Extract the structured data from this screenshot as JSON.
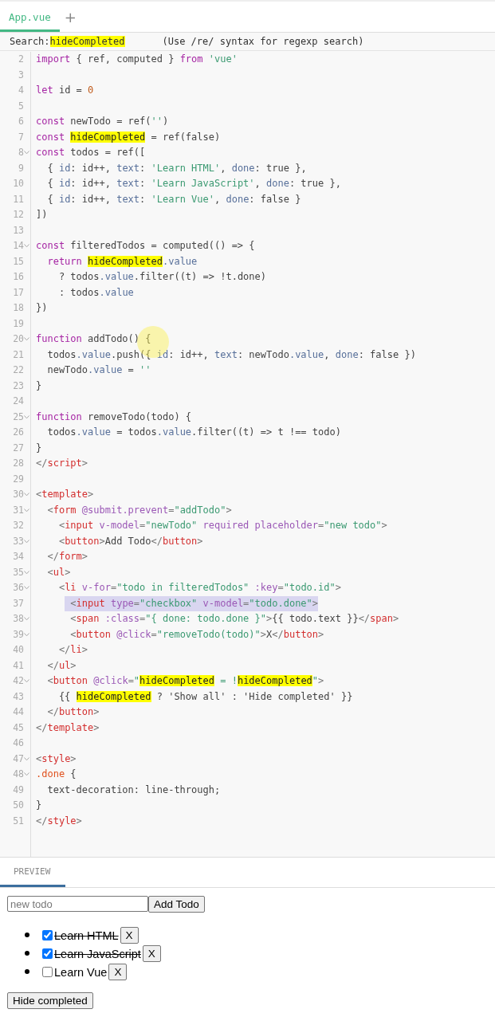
{
  "editor_tabs": [
    {
      "label": "App.vue",
      "selected": true
    }
  ],
  "add_tab_button": "+",
  "search": {
    "label": "Search:",
    "value": "hideCompleted",
    "hint": "(Use /re/ syntax for regexp search)"
  },
  "code_lines": [
    {
      "number": "2",
      "foldable": false,
      "highlighted": false,
      "tokens": [
        {
          "kind": "kw",
          "text": "import"
        },
        {
          "kind": "plain",
          "text": " { ref, computed } "
        },
        {
          "kind": "kw",
          "text": "from"
        },
        {
          "kind": "str",
          "text": " 'vue'"
        }
      ]
    },
    {
      "number": "3",
      "foldable": false,
      "highlighted": false
    },
    {
      "number": "4",
      "foldable": false,
      "highlighted": false,
      "tokens": [
        {
          "kind": "kw",
          "text": "let"
        },
        {
          "kind": "plain",
          "text": " id = "
        },
        {
          "kind": "num",
          "text": "0"
        }
      ]
    },
    {
      "number": "5",
      "foldable": false,
      "highlighted": false
    },
    {
      "number": "6",
      "foldable": false,
      "highlighted": false,
      "tokens": [
        {
          "kind": "kw",
          "text": "const"
        },
        {
          "kind": "plain",
          "text": " newTodo = ref("
        },
        {
          "kind": "str",
          "text": "''"
        },
        {
          "kind": "plain",
          "text": ")"
        }
      ]
    },
    {
      "number": "7",
      "foldable": false,
      "highlighted": false,
      "tokens": [
        {
          "kind": "kw",
          "text": "const "
        },
        {
          "kind": "match",
          "text": "hideCompleted"
        },
        {
          "kind": "plain",
          "text": " = ref(false)"
        }
      ]
    },
    {
      "number": "8",
      "foldable": true,
      "highlighted": false,
      "tokens": [
        {
          "kind": "kw",
          "text": "const"
        },
        {
          "kind": "plain",
          "text": " todos = ref(["
        }
      ]
    },
    {
      "number": "9",
      "foldable": false,
      "highlighted": false,
      "tokens": [
        {
          "kind": "plain",
          "text": "  { "
        },
        {
          "kind": "prop",
          "text": "id"
        },
        {
          "kind": "plain",
          "text": ": id++, "
        },
        {
          "kind": "prop",
          "text": "text"
        },
        {
          "kind": "plain",
          "text": ": "
        },
        {
          "kind": "str",
          "text": "'Learn HTML'"
        },
        {
          "kind": "plain",
          "text": ", "
        },
        {
          "kind": "prop",
          "text": "done"
        },
        {
          "kind": "plain",
          "text": ": true },"
        }
      ]
    },
    {
      "number": "10",
      "foldable": false,
      "highlighted": false,
      "tokens": [
        {
          "kind": "plain",
          "text": "  { "
        },
        {
          "kind": "prop",
          "text": "id"
        },
        {
          "kind": "plain",
          "text": ": id++, "
        },
        {
          "kind": "prop",
          "text": "text"
        },
        {
          "kind": "plain",
          "text": ": "
        },
        {
          "kind": "str",
          "text": "'Learn JavaScript'"
        },
        {
          "kind": "plain",
          "text": ", "
        },
        {
          "kind": "prop",
          "text": "done"
        },
        {
          "kind": "plain",
          "text": ": true },"
        }
      ]
    },
    {
      "number": "11",
      "foldable": false,
      "highlighted": false,
      "tokens": [
        {
          "kind": "plain",
          "text": "  { "
        },
        {
          "kind": "prop",
          "text": "id"
        },
        {
          "kind": "plain",
          "text": ": id++, "
        },
        {
          "kind": "prop",
          "text": "text"
        },
        {
          "kind": "plain",
          "text": ": "
        },
        {
          "kind": "str",
          "text": "'Learn Vue'"
        },
        {
          "kind": "plain",
          "text": ", "
        },
        {
          "kind": "prop",
          "text": "done"
        },
        {
          "kind": "plain",
          "text": ": false }"
        }
      ]
    },
    {
      "number": "12",
      "foldable": false,
      "highlighted": false,
      "tokens": [
        {
          "kind": "plain",
          "text": "])"
        }
      ]
    },
    {
      "number": "13",
      "foldable": false,
      "highlighted": false
    },
    {
      "number": "14",
      "foldable": true,
      "highlighted": false,
      "tokens": [
        {
          "kind": "kw",
          "text": "const"
        },
        {
          "kind": "plain",
          "text": " filteredTodos = computed(() => {"
        }
      ]
    },
    {
      "number": "15",
      "foldable": false,
      "highlighted": false,
      "tokens": [
        {
          "kind": "kw",
          "text": "  return "
        },
        {
          "kind": "match",
          "text": "hideCompleted"
        },
        {
          "kind": "prop",
          "text": ".value"
        }
      ]
    },
    {
      "number": "16",
      "foldable": false,
      "highlighted": false,
      "tokens": [
        {
          "kind": "plain",
          "text": "    ? todos"
        },
        {
          "kind": "prop",
          "text": ".value"
        },
        {
          "kind": "plain",
          "text": ".filter((t) => !t.done)"
        }
      ]
    },
    {
      "number": "17",
      "foldable": false,
      "highlighted": false,
      "tokens": [
        {
          "kind": "plain",
          "text": "    : todos"
        },
        {
          "kind": "prop",
          "text": ".value"
        }
      ]
    },
    {
      "number": "18",
      "foldable": false,
      "highlighted": false,
      "tokens": [
        {
          "kind": "plain",
          "text": "})"
        }
      ]
    },
    {
      "number": "19",
      "foldable": false,
      "highlighted": false
    },
    {
      "number": "20",
      "foldable": true,
      "highlighted": false,
      "tokens": [
        {
          "kind": "kw",
          "text": "function"
        },
        {
          "kind": "plain",
          "text": " addTodo() {"
        }
      ]
    },
    {
      "number": "21",
      "foldable": false,
      "highlighted": false,
      "tokens": [
        {
          "kind": "plain",
          "text": "  todos"
        },
        {
          "kind": "prop",
          "text": ".value"
        },
        {
          "kind": "plain",
          "text": ".push({ "
        },
        {
          "kind": "prop",
          "text": "id"
        },
        {
          "kind": "plain",
          "text": ": id++, "
        },
        {
          "kind": "prop",
          "text": "text"
        },
        {
          "kind": "plain",
          "text": ": newTodo"
        },
        {
          "kind": "prop",
          "text": ".value"
        },
        {
          "kind": "plain",
          "text": ", "
        },
        {
          "kind": "prop",
          "text": "done"
        },
        {
          "kind": "plain",
          "text": ": false })"
        }
      ]
    },
    {
      "number": "22",
      "foldable": false,
      "highlighted": false,
      "tokens": [
        {
          "kind": "plain",
          "text": "  newTodo"
        },
        {
          "kind": "prop",
          "text": ".value"
        },
        {
          "kind": "plain",
          "text": " = "
        },
        {
          "kind": "str",
          "text": "''"
        }
      ]
    },
    {
      "number": "23",
      "foldable": false,
      "highlighted": false,
      "tokens": [
        {
          "kind": "plain",
          "text": "}"
        }
      ]
    },
    {
      "number": "24",
      "foldable": false,
      "highlighted": false
    },
    {
      "number": "25",
      "foldable": true,
      "highlighted": false,
      "tokens": [
        {
          "kind": "kw",
          "text": "function"
        },
        {
          "kind": "plain",
          "text": " removeTodo(todo) {"
        }
      ]
    },
    {
      "number": "26",
      "foldable": false,
      "highlighted": false,
      "tokens": [
        {
          "kind": "plain",
          "text": "  todos"
        },
        {
          "kind": "prop",
          "text": ".value"
        },
        {
          "kind": "plain",
          "text": " = todos"
        },
        {
          "kind": "prop",
          "text": ".value"
        },
        {
          "kind": "plain",
          "text": ".filter((t) => t !== todo)"
        }
      ]
    },
    {
      "number": "27",
      "foldable": false,
      "highlighted": false,
      "tokens": [
        {
          "kind": "plain",
          "text": "}"
        }
      ]
    },
    {
      "number": "28",
      "foldable": false,
      "highlighted": false,
      "tokens": [
        {
          "kind": "punct",
          "text": "</"
        },
        {
          "kind": "tag",
          "text": "script"
        },
        {
          "kind": "punct",
          "text": ">"
        }
      ]
    },
    {
      "number": "29",
      "foldable": false,
      "highlighted": false
    },
    {
      "number": "30",
      "foldable": true,
      "highlighted": false,
      "tokens": [
        {
          "kind": "punct",
          "text": "<"
        },
        {
          "kind": "tag",
          "text": "template"
        },
        {
          "kind": "punct",
          "text": ">"
        }
      ]
    },
    {
      "number": "31",
      "foldable": true,
      "highlighted": false,
      "tokens": [
        {
          "kind": "punct",
          "text": "  <"
        },
        {
          "kind": "tag",
          "text": "form"
        },
        {
          "kind": "attr",
          "text": " @submit.prevent"
        },
        {
          "kind": "punct",
          "text": "="
        },
        {
          "kind": "str",
          "text": "\"addTodo\""
        },
        {
          "kind": "punct",
          "text": ">"
        }
      ]
    },
    {
      "number": "32",
      "foldable": false,
      "highlighted": false,
      "tokens": [
        {
          "kind": "punct",
          "text": "    <"
        },
        {
          "kind": "tag",
          "text": "input"
        },
        {
          "kind": "attr",
          "text": " v-model"
        },
        {
          "kind": "punct",
          "text": "="
        },
        {
          "kind": "str",
          "text": "\"newTodo\""
        },
        {
          "kind": "attr",
          "text": " required placeholder"
        },
        {
          "kind": "punct",
          "text": "="
        },
        {
          "kind": "str",
          "text": "\"new todo\""
        },
        {
          "kind": "punct",
          "text": ">"
        }
      ]
    },
    {
      "number": "33",
      "foldable": true,
      "highlighted": false,
      "tokens": [
        {
          "kind": "punct",
          "text": "    <"
        },
        {
          "kind": "tag",
          "text": "button"
        },
        {
          "kind": "punct",
          "text": ">"
        },
        {
          "kind": "plain",
          "text": "Add Todo"
        },
        {
          "kind": "punct",
          "text": "</"
        },
        {
          "kind": "tag",
          "text": "button"
        },
        {
          "kind": "punct",
          "text": ">"
        }
      ]
    },
    {
      "number": "34",
      "foldable": false,
      "highlighted": false,
      "tokens": [
        {
          "kind": "punct",
          "text": "  </"
        },
        {
          "kind": "tag",
          "text": "form"
        },
        {
          "kind": "punct",
          "text": ">"
        }
      ]
    },
    {
      "number": "35",
      "foldable": true,
      "highlighted": false,
      "tokens": [
        {
          "kind": "punct",
          "text": "  <"
        },
        {
          "kind": "tag",
          "text": "ul"
        },
        {
          "kind": "punct",
          "text": ">"
        }
      ]
    },
    {
      "number": "36",
      "foldable": true,
      "highlighted": false,
      "tokens": [
        {
          "kind": "punct",
          "text": "    <"
        },
        {
          "kind": "tag",
          "text": "li"
        },
        {
          "kind": "attr",
          "text": " v-for"
        },
        {
          "kind": "punct",
          "text": "="
        },
        {
          "kind": "str",
          "text": "\"todo in filteredTodos\""
        },
        {
          "kind": "attr",
          "text": " :key"
        },
        {
          "kind": "punct",
          "text": "="
        },
        {
          "kind": "str",
          "text": "\"todo.id\""
        },
        {
          "kind": "punct",
          "text": ">"
        }
      ]
    },
    {
      "number": "37",
      "foldable": false,
      "highlighted": true,
      "tokens": [
        {
          "kind": "punct",
          "text": "      <"
        },
        {
          "kind": "tag",
          "text": "input"
        },
        {
          "kind": "attr",
          "text": " type"
        },
        {
          "kind": "punct",
          "text": "="
        },
        {
          "kind": "str",
          "text": "\"checkbox\""
        },
        {
          "kind": "attr",
          "text": " v-model"
        },
        {
          "kind": "punct",
          "text": "="
        },
        {
          "kind": "str",
          "text": "\"todo.done\""
        },
        {
          "kind": "punct",
          "text": ">"
        }
      ]
    },
    {
      "number": "38",
      "foldable": true,
      "highlighted": false,
      "tokens": [
        {
          "kind": "punct",
          "text": "      <"
        },
        {
          "kind": "tag",
          "text": "span"
        },
        {
          "kind": "attr",
          "text": " :class"
        },
        {
          "kind": "punct",
          "text": "="
        },
        {
          "kind": "str",
          "text": "\"{ done: todo.done }\""
        },
        {
          "kind": "punct",
          "text": ">"
        },
        {
          "kind": "plain",
          "text": "{{ todo.text }}"
        },
        {
          "kind": "punct",
          "text": "</"
        },
        {
          "kind": "tag",
          "text": "span"
        },
        {
          "kind": "punct",
          "text": ">"
        }
      ]
    },
    {
      "number": "39",
      "foldable": true,
      "highlighted": false,
      "tokens": [
        {
          "kind": "punct",
          "text": "      <"
        },
        {
          "kind": "tag",
          "text": "button"
        },
        {
          "kind": "attr",
          "text": " @click"
        },
        {
          "kind": "punct",
          "text": "="
        },
        {
          "kind": "str",
          "text": "\"removeTodo(todo)\""
        },
        {
          "kind": "punct",
          "text": ">"
        },
        {
          "kind": "plain",
          "text": "X"
        },
        {
          "kind": "punct",
          "text": "</"
        },
        {
          "kind": "tag",
          "text": "button"
        },
        {
          "kind": "punct",
          "text": ">"
        }
      ]
    },
    {
      "number": "40",
      "foldable": false,
      "highlighted": false,
      "tokens": [
        {
          "kind": "punct",
          "text": "    </"
        },
        {
          "kind": "tag",
          "text": "li"
        },
        {
          "kind": "punct",
          "text": ">"
        }
      ]
    },
    {
      "number": "41",
      "foldable": false,
      "highlighted": false,
      "tokens": [
        {
          "kind": "punct",
          "text": "  </"
        },
        {
          "kind": "tag",
          "text": "ul"
        },
        {
          "kind": "punct",
          "text": ">"
        }
      ]
    },
    {
      "number": "42",
      "foldable": true,
      "highlighted": false,
      "tokens": [
        {
          "kind": "punct",
          "text": "  <"
        },
        {
          "kind": "tag",
          "text": "button"
        },
        {
          "kind": "attr",
          "text": " @click"
        },
        {
          "kind": "punct",
          "text": "="
        },
        {
          "kind": "str",
          "text": "\""
        },
        {
          "kind": "match",
          "text": "hideCompleted"
        },
        {
          "kind": "str",
          "text": " = !"
        },
        {
          "kind": "match",
          "text": "hideCompleted"
        },
        {
          "kind": "str",
          "text": "\""
        },
        {
          "kind": "punct",
          "text": ">"
        }
      ]
    },
    {
      "number": "43",
      "foldable": false,
      "highlighted": false,
      "tokens": [
        {
          "kind": "plain",
          "text": "    {{ "
        },
        {
          "kind": "match",
          "text": "hideCompleted"
        },
        {
          "kind": "plain",
          "text": " ? 'Show all' : 'Hide completed' }}"
        }
      ]
    },
    {
      "number": "44",
      "foldable": false,
      "highlighted": false,
      "tokens": [
        {
          "kind": "punct",
          "text": "  </"
        },
        {
          "kind": "tag",
          "text": "button"
        },
        {
          "kind": "punct",
          "text": ">"
        }
      ]
    },
    {
      "number": "45",
      "foldable": false,
      "highlighted": false,
      "tokens": [
        {
          "kind": "punct",
          "text": "</"
        },
        {
          "kind": "tag",
          "text": "template"
        },
        {
          "kind": "punct",
          "text": ">"
        }
      ]
    },
    {
      "number": "46",
      "foldable": false,
      "highlighted": false
    },
    {
      "number": "47",
      "foldable": true,
      "highlighted": false,
      "tokens": [
        {
          "kind": "punct",
          "text": "<"
        },
        {
          "kind": "tag",
          "text": "style"
        },
        {
          "kind": "punct",
          "text": ">"
        }
      ]
    },
    {
      "number": "48",
      "foldable": true,
      "highlighted": false,
      "tokens": [
        {
          "kind": "sel",
          "text": ".done"
        },
        {
          "kind": "plain",
          "text": " {"
        }
      ]
    },
    {
      "number": "49",
      "foldable": false,
      "highlighted": false,
      "tokens": [
        {
          "kind": "plain",
          "text": "  text-decoration: line-through;"
        }
      ]
    },
    {
      "number": "50",
      "foldable": false,
      "highlighted": false,
      "tokens": [
        {
          "kind": "plain",
          "text": "}"
        }
      ]
    },
    {
      "number": "51",
      "foldable": false,
      "highlighted": false,
      "tokens": [
        {
          "kind": "punct",
          "text": "</"
        },
        {
          "kind": "tag",
          "text": "style"
        },
        {
          "kind": "punct",
          "text": ">"
        }
      ]
    }
  ],
  "preview_tabs": [
    {
      "label": "PREVIEW",
      "selected": true
    }
  ],
  "preview": {
    "new_todo_placeholder": "new todo",
    "add_button": "Add Todo",
    "todos": [
      {
        "text": "Learn HTML",
        "done": true,
        "remove_button": "X"
      },
      {
        "text": "Learn JavaScript",
        "done": true,
        "remove_button": "X"
      },
      {
        "text": "Learn Vue",
        "done": false,
        "remove_button": "X"
      }
    ],
    "toggle_button": "Hide completed"
  }
}
